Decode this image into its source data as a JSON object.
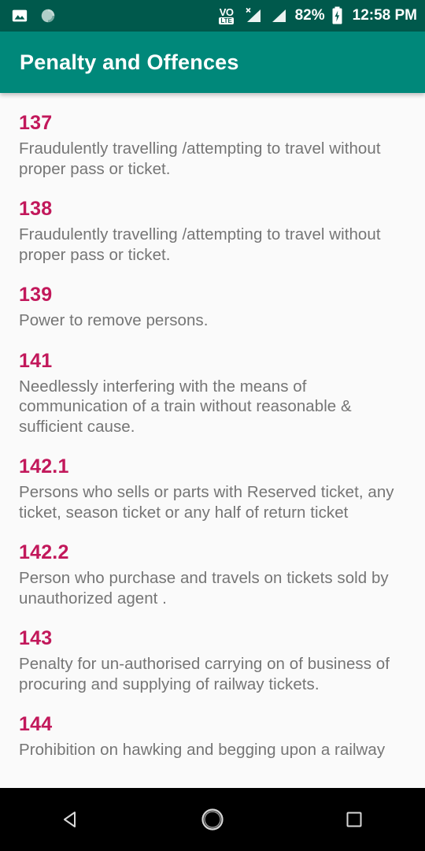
{
  "status_bar": {
    "icons_left": [
      "image-icon",
      "sync-progress-icon"
    ],
    "network_label_top": "VO",
    "network_label_bottom": "LTE",
    "signal_icons": [
      "signal-no-service-icon",
      "signal-bars-icon"
    ],
    "battery_percent": "82%",
    "battery_state": "charging",
    "time": "12:58 PM",
    "background_color": "#00594c"
  },
  "app_bar": {
    "title": "Penalty and Offences",
    "background_color": "#00887a",
    "title_color": "#ffffff"
  },
  "theme": {
    "accent_color": "#c2185b",
    "body_text_color": "#757575",
    "page_background": "#fafafa"
  },
  "list": {
    "entries": [
      {
        "number": "137",
        "description": "Fraudulently travelling /attempting to travel without proper pass or ticket."
      },
      {
        "number": "138",
        "description": "Fraudulently travelling /attempting to travel without proper pass or ticket."
      },
      {
        "number": "139",
        "description": "Power to remove persons."
      },
      {
        "number": "141",
        "description": "Needlessly interfering with the means of communication of a train without reasonable & sufficient cause."
      },
      {
        "number": "142.1",
        "description": "Persons who sells or parts with Reserved ticket, any ticket, season ticket or any half of return ticket"
      },
      {
        "number": "142.2",
        "description": "Person who purchase and travels on tickets sold by unauthorized agent ."
      },
      {
        "number": "143",
        "description": "Penalty for un-authorised carrying on of business of procuring and supplying of railway tickets."
      },
      {
        "number": "144",
        "description": "Prohibition on hawking and begging upon a railway"
      }
    ]
  },
  "nav_bar": {
    "buttons": [
      "back-button",
      "home-button",
      "recents-button"
    ],
    "background_color": "#000000"
  }
}
